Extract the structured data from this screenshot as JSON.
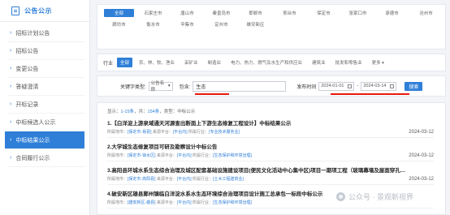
{
  "sidebar": {
    "title": "公告公示",
    "icon": "document-icon",
    "items": [
      {
        "label": "招标计划公告",
        "active": false
      },
      {
        "label": "招标公告",
        "active": false
      },
      {
        "label": "变更公告",
        "active": false
      },
      {
        "label": "答疑澄清",
        "active": false
      },
      {
        "label": "开标记录",
        "active": false
      },
      {
        "label": "中标候选人公示",
        "active": false
      },
      {
        "label": "中标结果公示",
        "active": true
      },
      {
        "label": "合同履行公示",
        "active": false
      }
    ]
  },
  "regions": [
    "全部",
    "石家庄市",
    "唐山市",
    "秦皇岛市",
    "邯郸市",
    "邢台市",
    "保定市",
    "张家口市",
    "承德市",
    "沧州市",
    "廊坊市",
    "衡水市",
    "辛集市",
    "定州市",
    "雄安新区"
  ],
  "industry": {
    "label": "行业",
    "items": [
      "全部",
      "农、林、牧、渔业",
      "采矿业",
      "制造业",
      "电力、热力、燃气及水生产和供应业",
      "建筑业",
      "批发和零售业",
      "更多"
    ]
  },
  "search": {
    "keyword_type_label": "关键字类型:",
    "keyword_type_value": "公告名称",
    "contains_label": "包含:",
    "keyword_value": "生态",
    "date_label": "发布时间",
    "date_from": "2024-01-01",
    "date_sep": "-",
    "date_to": "2024-03-14",
    "button_label": "搜索"
  },
  "results": {
    "info_prefix": "显示：",
    "info_range": "1-15条",
    "info_mid": "，共：",
    "info_total": "154条",
    "info_suffix": "，类型：中标公示",
    "items": [
      {
        "title": "1.【白洋淀上游泉域通天河源查出断面上下游生态修复工程设计】中标结果公示",
        "meta_prefix": "所属地市：",
        "city": "[保定市-易县]",
        "source_label": "来源平台：",
        "source": "[平台内]",
        "industry_label": "所属行业：",
        "industry": "[专业技术服务业]",
        "date": "2024-03-12"
      },
      {
        "title": "2.大学城生态修复项目可研及勘察设计中标公告",
        "meta_prefix": "所属地市：",
        "city": "[保定市-徐水区]",
        "source_label": "来源平台：",
        "source": "[平台内]",
        "industry_label": "所属行业：",
        "industry": "[生态保护和环境治理]",
        "date": "2024-03-12"
      },
      {
        "title": "3.高阳县环城水系生态综合治理及城区配套基础设施建设项目(便民文化活动中心集中区)项目一期项工程（玻璃幕墙及屋面穿孔…",
        "meta_prefix": "所属地市：",
        "city": "[保定市-高阳县]",
        "source_label": "来源平台：",
        "source": "[平台内]",
        "industry_label": "所属行业：",
        "industry": "[土木工程建筑业]",
        "date": "2024-03-12"
      },
      {
        "title": "4.破安新区雄县鄚州镇临白洋淀水系水生态环境综合治理项目设计施工总承包一标段中标公示",
        "meta_prefix": "所属地市：",
        "city": "[雄安新区-雄县]",
        "source_label": "来源平台：",
        "source": "[平台内]",
        "industry_label": "所属行业：",
        "industry": "[生态保护和环境治理]",
        "date": ""
      }
    ]
  },
  "watermark": "公众号 · 景观新视界",
  "colors": {
    "accent": "#2f7fd8",
    "highlight": "#e8190f"
  }
}
